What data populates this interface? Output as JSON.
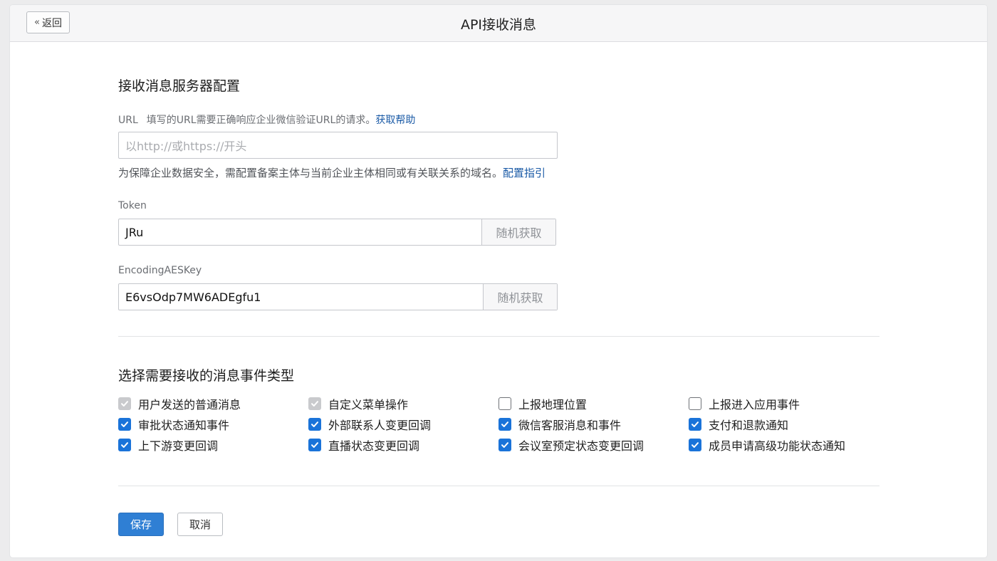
{
  "header": {
    "back_label": "返回",
    "title": "API接收消息"
  },
  "server_config": {
    "title": "接收消息服务器配置",
    "url_label": "URL",
    "url_hint": "填写的URL需要正确响应企业微信验证URL的请求。",
    "url_help_link": "获取帮助",
    "url_placeholder": "以http://或https://开头",
    "security_note": "为保障企业数据安全，需配置备案主体与当前企业主体相同或有关联关系的域名。",
    "config_guide_link": "配置指引",
    "token_label": "Token",
    "token_value": "JRu",
    "token_random_button": "随机获取",
    "aeskey_label": "EncodingAESKey",
    "aeskey_value": "E6vsOdp7MW6ADEgfu1",
    "aeskey_random_button": "随机获取"
  },
  "events": {
    "title": "选择需要接收的消息事件类型",
    "items": [
      {
        "label": "用户发送的普通消息",
        "state": "checked-disabled"
      },
      {
        "label": "自定义菜单操作",
        "state": "checked-disabled"
      },
      {
        "label": "上报地理位置",
        "state": "unchecked"
      },
      {
        "label": "上报进入应用事件",
        "state": "unchecked"
      },
      {
        "label": "审批状态通知事件",
        "state": "checked"
      },
      {
        "label": "外部联系人变更回调",
        "state": "checked"
      },
      {
        "label": "微信客服消息和事件",
        "state": "checked"
      },
      {
        "label": "支付和退款通知",
        "state": "checked"
      },
      {
        "label": "上下游变更回调",
        "state": "checked"
      },
      {
        "label": "直播状态变更回调",
        "state": "checked"
      },
      {
        "label": "会议室预定状态变更回调",
        "state": "checked"
      },
      {
        "label": "成员申请高级功能状态通知",
        "state": "checked"
      }
    ]
  },
  "actions": {
    "save_label": "保存",
    "cancel_label": "取消"
  },
  "colors": {
    "primary": "#2f7fd4",
    "checkbox_checked": "#1a73d9",
    "checkbox_disabled": "#c9cacd",
    "link": "#1a5aa6"
  }
}
